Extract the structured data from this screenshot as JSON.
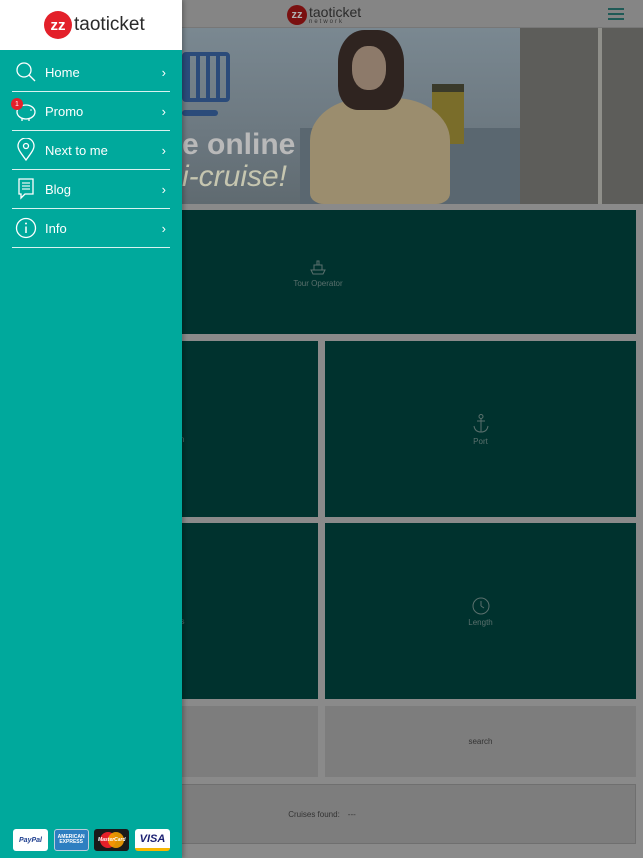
{
  "brand": {
    "name": "taoticket",
    "subtitle": "network",
    "mark": "zz"
  },
  "drawer": {
    "items": [
      {
        "label": "Home",
        "icon": "search-icon",
        "badge": null
      },
      {
        "label": "Promo",
        "icon": "piggy-bank-icon",
        "badge": "1"
      },
      {
        "label": "Next to me",
        "icon": "location-pin-icon",
        "badge": null
      },
      {
        "label": "Blog",
        "icon": "document-icon",
        "badge": null
      },
      {
        "label": "Info",
        "icon": "info-icon",
        "badge": null
      }
    ],
    "chevron": "›",
    "payments": {
      "paypal": "PayPal",
      "amex": "AMERICAN EXPRESS",
      "mastercard": "MasterCard",
      "visa": "VISA"
    }
  },
  "hero": {
    "line1": "e online",
    "line2": "i-cruise!"
  },
  "tiles": {
    "tour_operator": "Tour Operator",
    "left2_partial": "n",
    "port": "Port",
    "left3_partial": "es",
    "length": "Length",
    "search": "search"
  },
  "results": {
    "label": "Cruises found:",
    "value": "---"
  },
  "colors": {
    "drawer_bg": "#00a99c",
    "tile_bg": "#00322e",
    "brand_red": "#e3202a",
    "overlay_gray": "#8a8a8a"
  }
}
